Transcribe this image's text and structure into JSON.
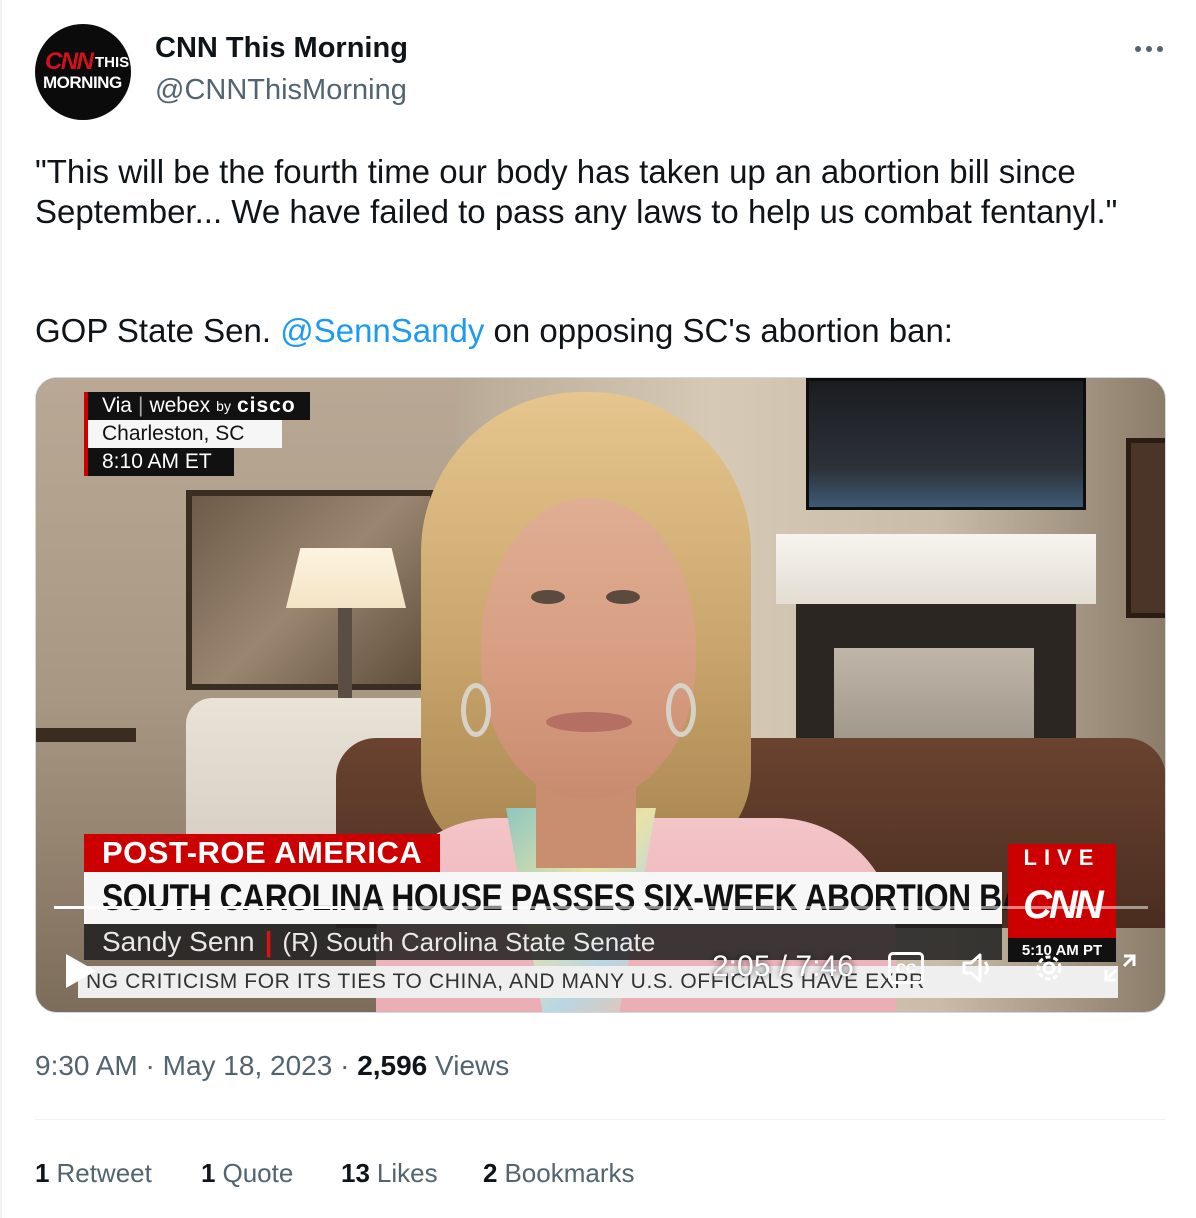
{
  "author": {
    "avatar_cnn": "CNN",
    "avatar_this": "THIS",
    "avatar_morning": "MORNING",
    "display_name": "CNN This Morning",
    "handle": "@CNNThisMorning"
  },
  "tweet": {
    "quote": "\"This will be the fourth time our body has taken up an abortion bill since September... We have failed to pass any laws to help us combat fentanyl.\"",
    "line2_prefix": "GOP State Sen. ",
    "mention": "@SennSandy",
    "line2_suffix": " on opposing SC's abortion ban:"
  },
  "video": {
    "via_label": "Via",
    "via_brand": "webex",
    "via_by": "by",
    "via_company": "cisco",
    "location": "Charleston, SC",
    "local_time": "8:10 AM ET",
    "kicker": "POST-ROE AMERICA",
    "headline": "SOUTH CAROLINA HOUSE PASSES SIX-WEEK ABORTION BAN",
    "guest_name": "Sandy Senn",
    "guest_role": "(R) South Carolina State Senate",
    "ticker": "NG CRITICISM FOR ITS TIES TO CHINA, AND MANY U.S. OFFICIALS HAVE EXPR",
    "live_tag": "LIVE",
    "network_logo": "CNN",
    "network_time": "5:10 AM PT",
    "playback_time": "2:05 / 7:46",
    "progress_fraction": 0.269,
    "cc_label": "CC"
  },
  "meta": {
    "time": "9:30 AM",
    "date": "May 18, 2023",
    "sep": "·",
    "views_count": "2,596",
    "views_label": "Views"
  },
  "stats": [
    {
      "count": "1",
      "label": "Retweet"
    },
    {
      "count": "1",
      "label": "Quote"
    },
    {
      "count": "13",
      "label": "Likes"
    },
    {
      "count": "2",
      "label": "Bookmarks"
    }
  ],
  "colors": {
    "link": "#1d9bf0",
    "secondary_text": "#536471",
    "cnn_red": "#cc0000"
  }
}
